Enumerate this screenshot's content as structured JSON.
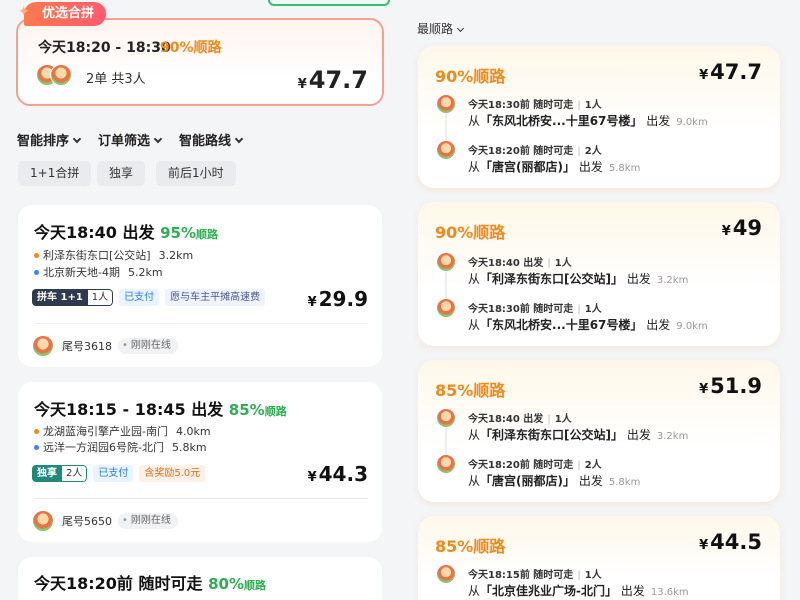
{
  "left": {
    "best": {
      "tag": "优选合拼",
      "time": "今天18:20 - 18:30",
      "pct": "90%顺路",
      "orders": "2单 共3人",
      "price": "47.7"
    },
    "filters": [
      "智能排序",
      "订单筛选",
      "智能路线"
    ],
    "chips": [
      "1+1合拼",
      "独享",
      "前后1小时"
    ],
    "orders": [
      {
        "title": "今天18:40 出发",
        "pct": "95%",
        "pct_suffix": "顺路",
        "stops": [
          {
            "name": "利泽东街东口[公交站]",
            "dist": "3.2km"
          },
          {
            "name": "北京新天地-4期",
            "dist": "5.2km"
          }
        ],
        "mode": "拼车 1+1",
        "mode_count": "1人",
        "paid": "已支付",
        "extra": "愿与车主平摊高速费",
        "price": "29.9",
        "tail": "尾号3618",
        "status": "刚刚在线"
      },
      {
        "title": "今天18:15 - 18:45 出发",
        "pct": "85%",
        "pct_suffix": "顺路",
        "stops": [
          {
            "name": "龙湖蓝海引擎产业园-南门",
            "dist": "4.0km"
          },
          {
            "name": "远洋一方润园6号院-北门",
            "dist": "5.8km"
          }
        ],
        "mode": "独享",
        "mode_count": "2人",
        "paid": "已支付",
        "extra": "含奖励5.0元",
        "price": "44.3",
        "tail": "尾号5650",
        "status": "刚刚在线"
      },
      {
        "title": "今天18:20前 随时可走",
        "pct": "80%",
        "pct_suffix": "顺路"
      }
    ]
  },
  "right": {
    "sort_label": "最顺路",
    "cards": [
      {
        "pct": "90%顺路",
        "price": "47.7",
        "legs": [
          {
            "meta": "今天18:30前 随时可走",
            "people": "1人",
            "from": "东风北桥安...十里67号楼",
            "dist": "9.0km"
          },
          {
            "meta": "今天18:20前 随时可走",
            "people": "2人",
            "from": "唐宫(丽都店)",
            "dist": "5.8km"
          }
        ]
      },
      {
        "pct": "90%顺路",
        "price": "49",
        "legs": [
          {
            "meta": "今天18:40 出发",
            "people": "1人",
            "from": "利泽东街东口[公交站]",
            "dist": "3.2km"
          },
          {
            "meta": "今天18:30前 随时可走",
            "people": "1人",
            "from": "东风北桥安...十里67号楼",
            "dist": "9.0km"
          }
        ]
      },
      {
        "pct": "85%顺路",
        "price": "51.9",
        "legs": [
          {
            "meta": "今天18:40 出发",
            "people": "1人",
            "from": "利泽东街东口[公交站]",
            "dist": "3.2km"
          },
          {
            "meta": "今天18:20前 随时可走",
            "people": "2人",
            "from": "唐宫(丽都店)",
            "dist": "5.8km"
          }
        ]
      },
      {
        "pct": "85%顺路",
        "price": "44.5",
        "legs": [
          {
            "meta": "今天18:15前 随时可走",
            "people": "1人",
            "from": "北京佳兆业广场-北门",
            "dist": "13.6km"
          }
        ]
      }
    ],
    "from_prefix": "从",
    "from_suffix": "出发",
    "quote_open": "「",
    "quote_close": "」"
  },
  "currency": "¥",
  "colors": {
    "accent_orange": "#f08a1c",
    "accent_green": "#2fae52",
    "best_border": "#f4a28f",
    "tag_gradient_start": "#ff7a4d",
    "tag_gradient_end": "#ff5a6e"
  }
}
